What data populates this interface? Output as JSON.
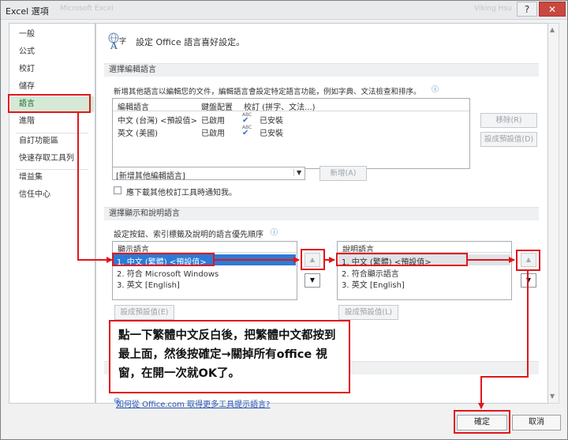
{
  "window": {
    "title": "Excel 選項",
    "ghost_text": "Microsoft Excel",
    "ghost_text2": "Viking Hsu",
    "help_label": "?",
    "close_label": "✕"
  },
  "sidebar": {
    "items": [
      {
        "label": "一般"
      },
      {
        "label": "公式"
      },
      {
        "label": "校訂"
      },
      {
        "label": "儲存"
      },
      {
        "label": "語言"
      },
      {
        "label": "進階"
      },
      {
        "label": "自訂功能區"
      },
      {
        "label": "快速存取工具列"
      },
      {
        "label": "增益集"
      },
      {
        "label": "信任中心"
      }
    ]
  },
  "header": {
    "text": "設定 Office 語言喜好設定。"
  },
  "editing": {
    "section_title": "選擇編輯語言",
    "description": "新增其他語言以編輯您的文件，編輯語言會設定特定語言功能，例如字典、文法檢查和排序。",
    "columns": [
      "編輯語言",
      "鍵盤配置",
      "校訂 (拼字、文法...)"
    ],
    "rows": [
      {
        "lang": "中文 (台灣) <預設值>",
        "keyboard": "已啟用",
        "proof": "已安裝"
      },
      {
        "lang": "英文 (美國)",
        "keyboard": "已啟用",
        "proof": "已安裝"
      }
    ],
    "remove_button": "移除(R)",
    "set_default_button": "設成預設值(D)",
    "add_select_value": "[新增其他編輯語言]",
    "add_button": "新增(A)",
    "checkbox_label": "應下載其他校訂工具時通知我。"
  },
  "display": {
    "section_title": "選擇顯示和說明語言",
    "description": "設定按鈕、索引標籤及說明的語言優先順序",
    "display_header": "顯示語言",
    "display_items": [
      "1.  中文 (繁體) <預設值>",
      "2.  符合 Microsoft Windows",
      "3.  英文 [English]"
    ],
    "help_header": "說明語言",
    "help_items": [
      "1.  中文 (繁體) <預設值>",
      "2.  符合顯示語言",
      "3.  英文 [English]"
    ],
    "set_default_button": "設成預設值(E)",
    "set_default_button2": "設成預設值(L)",
    "up_glyph": "▲",
    "down_glyph": "▼"
  },
  "annotation": {
    "text": "點一下繁體中文反白後，把繁體中文都按到最上面，然後按確定→關掉所有office 視窗，在開一次就OK了。"
  },
  "footer": {
    "link_text": "如何從 Office.com 取得更多工具提示語言?",
    "ok_button": "確定",
    "cancel_button": "取消"
  },
  "colors": {
    "annotation_red": "#e0161b",
    "selection_blue": "#2c7bd8",
    "selected_nav": "#d6e9d6"
  }
}
